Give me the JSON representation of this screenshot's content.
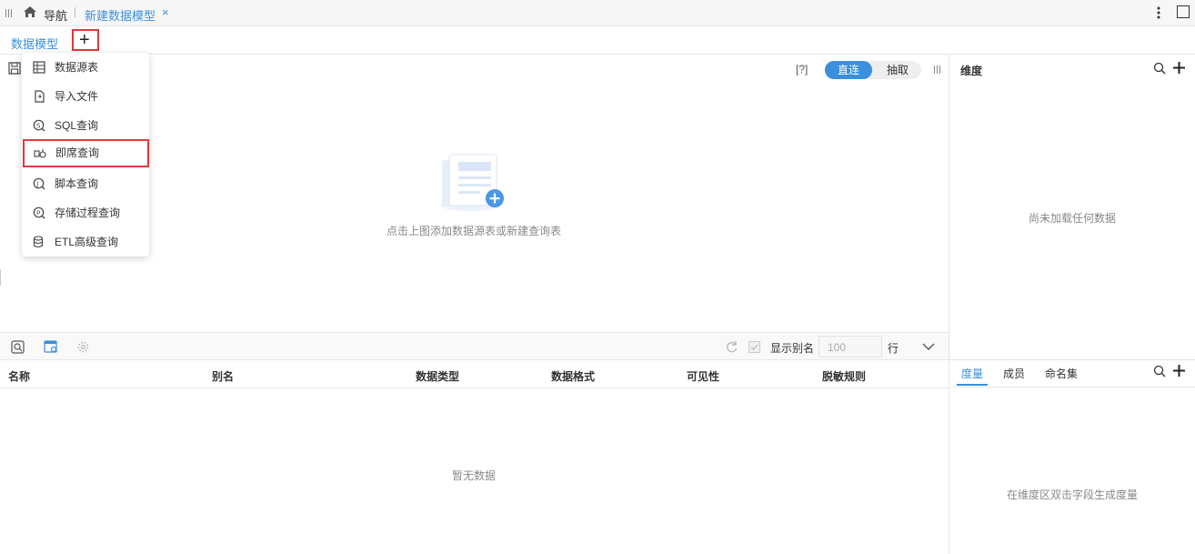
{
  "topbar": {
    "nav_label": "导航",
    "tab_title": "新建数据模型",
    "close": "×"
  },
  "tabbar": {
    "active_tab": "数据模型",
    "add": "+"
  },
  "menu": {
    "items": [
      "数据源表",
      "导入文件",
      "SQL查询",
      "即席查询",
      "脚本查询",
      "存储过程查询",
      "ETL高级查询"
    ]
  },
  "canvas": {
    "help": "[?]",
    "mode_on": "直连",
    "mode_off": "抽取",
    "hint": "点击上图添加数据源表或新建查询表"
  },
  "fields": {
    "show_alias_label": "显示别名",
    "rows_value": "100",
    "rows_unit": "行",
    "columns": [
      "名称",
      "别名",
      "数据类型",
      "数据格式",
      "可见性",
      "脱敏规则"
    ],
    "empty": "暂无数据"
  },
  "right": {
    "dimension_title": "维度",
    "dimension_empty": "尚未加载任何数据",
    "tabs": [
      "度量",
      "成员",
      "命名集"
    ],
    "measure_empty": "在维度区双击字段生成度量"
  },
  "colors": {
    "accent": "#3b8fdc",
    "highlight": "#e0393e"
  }
}
